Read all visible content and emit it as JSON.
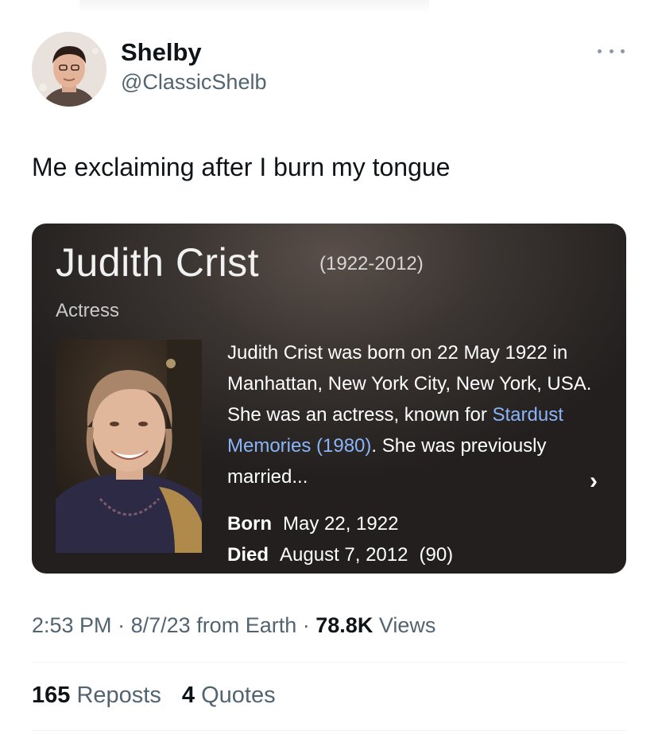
{
  "user": {
    "display_name": "Shelby",
    "handle": "@ClassicShelb",
    "avatar_icon": "avatar-photo"
  },
  "tweet": {
    "text": "Me exclaiming after I burn my tongue"
  },
  "card": {
    "name": "Judith Crist",
    "years": "(1922-2012)",
    "occupation": "Actress",
    "description_before_link": "Judith Crist was born on 22 May 1922 in Manhattan, New York City, New York, USA. She was an actress, known for ",
    "link_text": "Stardust Memories (1980)",
    "description_after_link": ". She was previously married...",
    "chevron": "›",
    "born_label": "Born",
    "born_value": "May 22, 1922",
    "died_label": "Died",
    "died_value": "August 7, 2012",
    "died_age": "(90)",
    "link_color": "#8ab4f8"
  },
  "meta": {
    "time": "2:53 PM",
    "date": "8/7/23",
    "source": "from Earth",
    "separator": "·",
    "views_count": "78.8K",
    "views_label": "Views"
  },
  "stats": {
    "reposts_count": "165",
    "reposts_label": "Reposts",
    "quotes_count": "4",
    "quotes_label": "Quotes"
  },
  "more_icon": "more-horizontal-icon"
}
